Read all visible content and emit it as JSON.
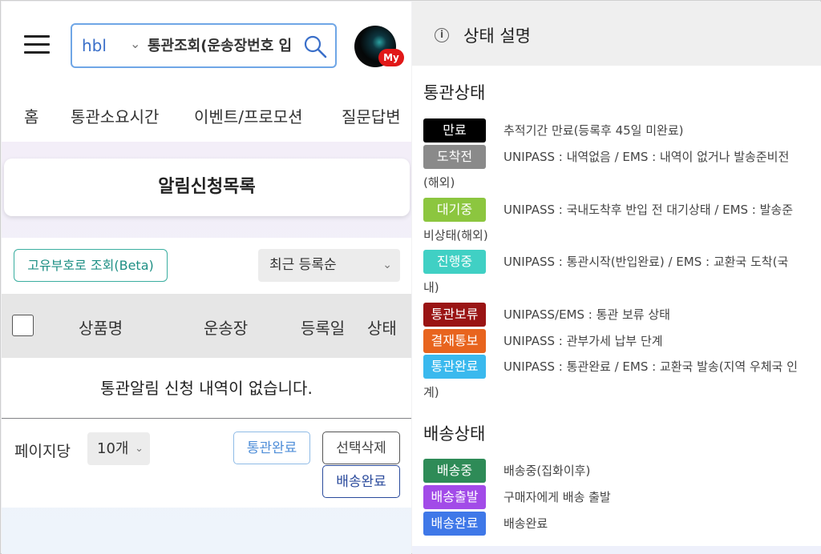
{
  "left": {
    "search": {
      "type": "hbl",
      "placeholder": "통관조회(운송장번호 입력)",
      "value": "통관조회(운송장번호 입"
    },
    "avatar_badge": "My",
    "nav": [
      "홈",
      "통관소요시간",
      "이벤트/프로모션",
      "질문답변"
    ],
    "page_title": "알림신청목록",
    "beta_button": "고유부호로 조회(Beta)",
    "sort": "최근 등록순",
    "table_headers": [
      "상품명",
      "운송장",
      "등록일",
      "상태"
    ],
    "empty_message": "통관알림 신청 내역이 없습니다.",
    "per_page_label": "페이지당",
    "per_page_value": "10개",
    "buttons": {
      "complete": "통관완료",
      "delete": "선택삭제",
      "ship_complete": "배송완료"
    }
  },
  "right": {
    "title": "상태 설명",
    "customs_section": "통관상태",
    "customs_statuses": [
      {
        "badge": "만료",
        "color": "#000000",
        "desc": "추적기간 만료(등록후 45일 미완료)",
        "desc2": ""
      },
      {
        "badge": "도착전",
        "color": "#8a8a8a",
        "desc": "UNIPASS : 내역없음 / EMS : 내역이 없거나 발송준비전",
        "desc2": "(해외)"
      },
      {
        "badge": "대기중",
        "color": "#8cc63f",
        "desc": "UNIPASS : 국내도착후 반입 전 대기상태 / EMS : 발송준",
        "desc2": "비상태(해외)"
      },
      {
        "badge": "진행중",
        "color": "#40d0c4",
        "desc": "UNIPASS : 통관시작(반입완료) / EMS : 교환국 도착(국",
        "desc2": "내)"
      },
      {
        "badge": "통관보류",
        "color": "#9a1414",
        "desc": "UNIPASS/EMS : 통관 보류 상태",
        "desc2": ""
      },
      {
        "badge": "결재통보",
        "color": "#e8641e",
        "desc": "UNIPASS : 관부가세 납부 단계",
        "desc2": ""
      },
      {
        "badge": "통관완료",
        "color": "#3ab9ee",
        "desc": "UNIPASS : 통관완료 / EMS : 교환국 발송(지역 우체국 인",
        "desc2": "계)"
      }
    ],
    "delivery_section": "배송상태",
    "delivery_statuses": [
      {
        "badge": "배송중",
        "color": "#2e8b57",
        "desc": "배송중(집화이후)"
      },
      {
        "badge": "배송출발",
        "color": "#a24be8",
        "desc": "구매자에게 배송 출발"
      },
      {
        "badge": "배송완료",
        "color": "#3f78e8",
        "desc": "배송완료"
      }
    ]
  }
}
